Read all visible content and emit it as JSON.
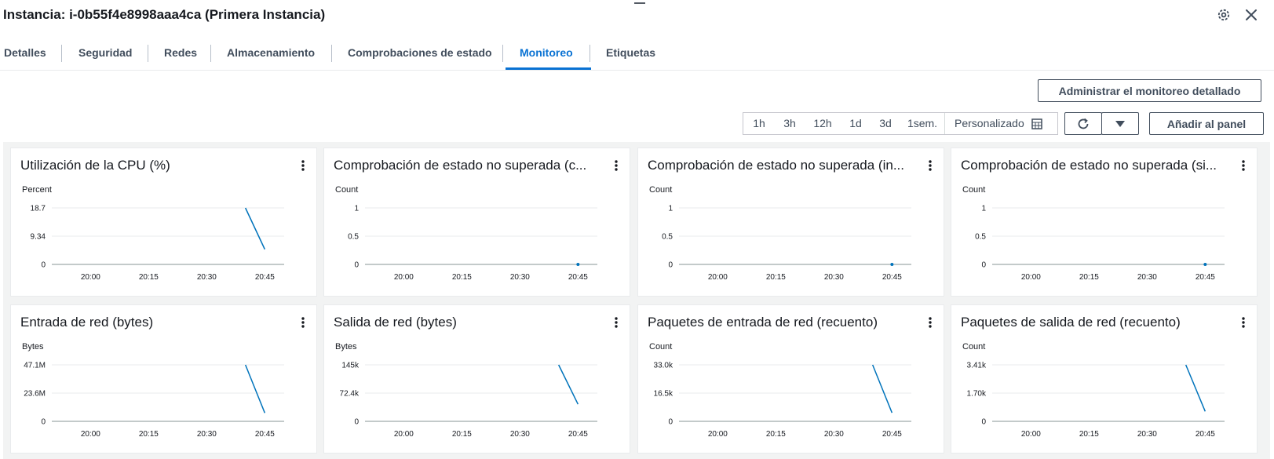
{
  "header": {
    "title": "Instancia: i-0b55f4e8998aaa4ca (Primera Instancia)"
  },
  "tabs": [
    {
      "label": "Detalles"
    },
    {
      "label": "Seguridad"
    },
    {
      "label": "Redes"
    },
    {
      "label": "Almacenamiento"
    },
    {
      "label": "Comprobaciones de estado"
    },
    {
      "label": "Monitoreo"
    },
    {
      "label": "Etiquetas"
    }
  ],
  "active_tab": "Monitoreo",
  "toolbar": {
    "manage_label": "Administrar el monitoreo detallado",
    "ranges": [
      "1h",
      "3h",
      "12h",
      "1d",
      "3d",
      "1sem."
    ],
    "custom_label": "Personalizado",
    "add_label": "Añadir al panel"
  },
  "colors": {
    "accent": "#0972d3",
    "series": "#0073bb"
  },
  "chart_data": [
    {
      "type": "line",
      "title": "Utilización de la CPU (%)",
      "ylabel": "Percent",
      "ylim": [
        0,
        18.7
      ],
      "yticks": [
        "18.7",
        "9.34",
        "0"
      ],
      "xticks": [
        "20:00",
        "20:15",
        "20:30",
        "20:45"
      ],
      "series": [
        {
          "values": [
            {
              "x": "20:40",
              "y": 18.7
            },
            {
              "x": "20:45",
              "y": 5.0
            }
          ]
        }
      ]
    },
    {
      "type": "line",
      "title": "Comprobación de estado no superada (c...",
      "ylabel": "Count",
      "ylim": [
        0,
        1
      ],
      "yticks": [
        "1",
        "0.5",
        "0"
      ],
      "xticks": [
        "20:00",
        "20:15",
        "20:30",
        "20:45"
      ],
      "series": [
        {
          "values": [
            {
              "x": "20:45",
              "y": 0
            }
          ]
        }
      ]
    },
    {
      "type": "line",
      "title": "Comprobación de estado no superada (in...",
      "ylabel": "Count",
      "ylim": [
        0,
        1
      ],
      "yticks": [
        "1",
        "0.5",
        "0"
      ],
      "xticks": [
        "20:00",
        "20:15",
        "20:30",
        "20:45"
      ],
      "series": [
        {
          "values": [
            {
              "x": "20:45",
              "y": 0
            }
          ]
        }
      ]
    },
    {
      "type": "line",
      "title": "Comprobación de estado no superada (si...",
      "ylabel": "Count",
      "ylim": [
        0,
        1
      ],
      "yticks": [
        "1",
        "0.5",
        "0"
      ],
      "xticks": [
        "20:00",
        "20:15",
        "20:30",
        "20:45"
      ],
      "series": [
        {
          "values": [
            {
              "x": "20:45",
              "y": 0
            }
          ]
        }
      ]
    },
    {
      "type": "line",
      "title": "Entrada de red (bytes)",
      "ylabel": "Bytes",
      "ylim": [
        0,
        47.1
      ],
      "yticks": [
        "47.1M",
        "23.6M",
        "0"
      ],
      "xticks": [
        "20:00",
        "20:15",
        "20:30",
        "20:45"
      ],
      "series": [
        {
          "values": [
            {
              "x": "20:40",
              "y": 47.1
            },
            {
              "x": "20:45",
              "y": 7
            }
          ]
        }
      ]
    },
    {
      "type": "line",
      "title": "Salida de red (bytes)",
      "ylabel": "Bytes",
      "ylim": [
        0,
        145
      ],
      "yticks": [
        "145k",
        "72.4k",
        "0"
      ],
      "xticks": [
        "20:00",
        "20:15",
        "20:30",
        "20:45"
      ],
      "series": [
        {
          "values": [
            {
              "x": "20:40",
              "y": 145
            },
            {
              "x": "20:45",
              "y": 44
            }
          ]
        }
      ]
    },
    {
      "type": "line",
      "title": "Paquetes de entrada de red (recuento)",
      "ylabel": "Count",
      "ylim": [
        0,
        33.0
      ],
      "yticks": [
        "33.0k",
        "16.5k",
        "0"
      ],
      "xticks": [
        "20:00",
        "20:15",
        "20:30",
        "20:45"
      ],
      "series": [
        {
          "values": [
            {
              "x": "20:40",
              "y": 33.0
            },
            {
              "x": "20:45",
              "y": 5
            }
          ]
        }
      ]
    },
    {
      "type": "line",
      "title": "Paquetes de salida de red (recuento)",
      "ylabel": "Count",
      "ylim": [
        0,
        3.41
      ],
      "yticks": [
        "3.41k",
        "1.70k",
        "0"
      ],
      "xticks": [
        "20:00",
        "20:15",
        "20:30",
        "20:45"
      ],
      "series": [
        {
          "values": [
            {
              "x": "20:40",
              "y": 3.41
            },
            {
              "x": "20:45",
              "y": 0.6
            }
          ]
        }
      ]
    }
  ]
}
